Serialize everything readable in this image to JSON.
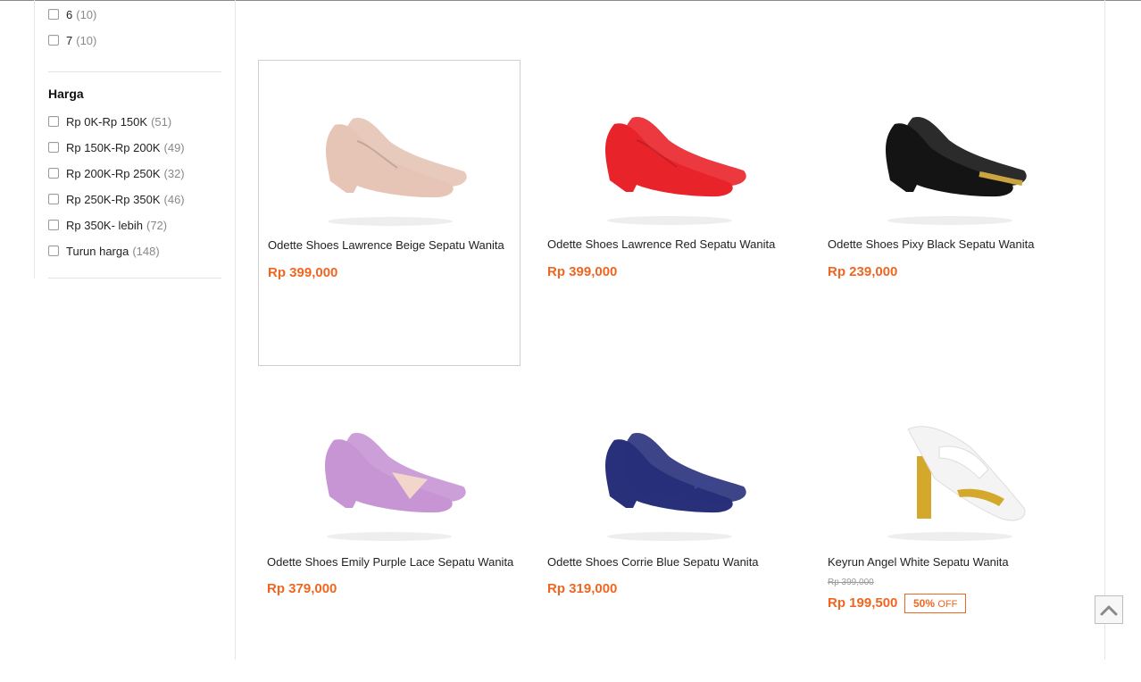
{
  "filters": {
    "size_options": [
      {
        "label": "6",
        "count": "(10)"
      },
      {
        "label": "7",
        "count": "(10)"
      }
    ],
    "price_section_title": "Harga",
    "price_options": [
      {
        "label": "Rp 0K-Rp 150K",
        "count": "(51)"
      },
      {
        "label": "Rp 150K-Rp 200K",
        "count": "(49)"
      },
      {
        "label": "Rp 200K-Rp 250K",
        "count": "(32)"
      },
      {
        "label": "Rp 250K-Rp 350K",
        "count": "(46)"
      },
      {
        "label": "Rp 350K- lebih",
        "count": "(72)"
      },
      {
        "label": "Turun harga",
        "count": "(148)"
      }
    ]
  },
  "products": [
    {
      "name": "Odette Shoes Lawrence Beige Sepatu Wanita",
      "price": "Rp 399,000",
      "color": "#e6c4b6"
    },
    {
      "name": "Odette Shoes Lawrence Red Sepatu Wanita",
      "price": "Rp 399,000",
      "color": "#e9232a"
    },
    {
      "name": "Odette Shoes Pixy Black Sepatu Wanita",
      "price": "Rp 239,000",
      "color": "#141414"
    },
    {
      "name": "Odette Shoes Emily Purple Lace Sepatu Wanita",
      "price": "Rp 379,000",
      "color": "#c895d4"
    },
    {
      "name": "Odette Shoes Corrie Blue Sepatu Wanita",
      "price": "Rp 319,000",
      "color": "#28307a"
    },
    {
      "name": "Keyrun Angel White Sepatu Wanita",
      "price": "Rp 199,500",
      "old_price": "Rp 399,000",
      "discount": "50%",
      "discount_suffix": "OFF",
      "color": "#f4f4f4"
    }
  ],
  "colors": {
    "accent": "#ef6622"
  },
  "scroll_top_icon": "chevron-up-icon"
}
